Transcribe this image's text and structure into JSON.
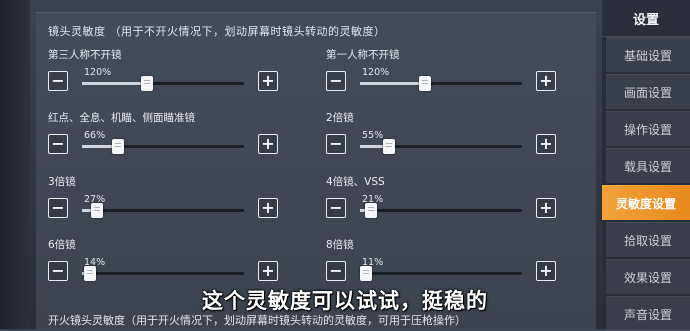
{
  "sections": {
    "scope_sensitivity_title": "镜头灵敏度 （用于不开火情况下，划动屏幕时镜头转动的灵敏度）",
    "fire_scope_sensitivity_title": "开火镜头灵敏度（用于开火情况下，划动屏幕时镜头转动的灵敏度，可用于压枪操作）"
  },
  "sliders": [
    {
      "label": "第三人称不开镜",
      "value_text": "120%",
      "value": 0.4
    },
    {
      "label": "第一人称不开镜",
      "value_text": "120%",
      "value": 0.4
    },
    {
      "label": "红点、全息、机瞄、侧面瞄准镜",
      "value_text": "66%",
      "value": 0.22
    },
    {
      "label": "2倍镜",
      "value_text": "55%",
      "value": 0.18
    },
    {
      "label": "3倍镜",
      "value_text": "27%",
      "value": 0.09
    },
    {
      "label": "4倍镜、VSS",
      "value_text": "21%",
      "value": 0.07
    },
    {
      "label": "6倍镜",
      "value_text": "14%",
      "value": 0.05
    },
    {
      "label": "8倍镜",
      "value_text": "11%",
      "value": 0.04
    }
  ],
  "buttons": {
    "minus": "−",
    "plus": "+"
  },
  "sidebar": {
    "title": "设置",
    "items": [
      {
        "label": "基础设置"
      },
      {
        "label": "画面设置"
      },
      {
        "label": "操作设置"
      },
      {
        "label": "载具设置"
      },
      {
        "label": "灵敏度设置",
        "active": true
      },
      {
        "label": "拾取设置"
      },
      {
        "label": "效果设置"
      },
      {
        "label": "声音设置"
      }
    ]
  },
  "subtitle": "这个灵敏度可以试试，挺稳的",
  "colors": {
    "accent": "#f2a23a",
    "track": "#1b1f26",
    "fill": "#cfd5dd"
  }
}
